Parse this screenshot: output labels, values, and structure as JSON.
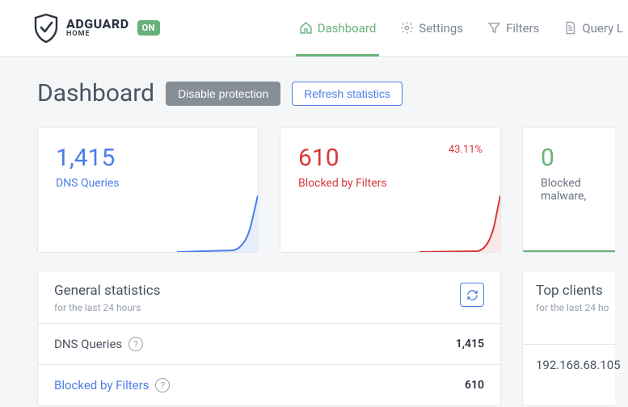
{
  "brand": {
    "name": "ADGUARD",
    "sub": "HOME",
    "status": "ON"
  },
  "nav": {
    "dashboard": "Dashboard",
    "settings": "Settings",
    "filters": "Filters",
    "querylog": "Query L"
  },
  "title": "Dashboard",
  "buttons": {
    "disable": "Disable protection",
    "refresh": "Refresh statistics"
  },
  "cards": {
    "queries": {
      "value": "1,415",
      "label": "DNS Queries"
    },
    "blocked": {
      "value": "610",
      "label": "Blocked by Filters",
      "pct": "43.11%"
    },
    "malware": {
      "value": "0",
      "label": "Blocked malware,"
    }
  },
  "stats": {
    "title": "General statistics",
    "sub": "for the last 24 hours",
    "rows": [
      {
        "label": "DNS Queries",
        "value": "1,415",
        "link": false
      },
      {
        "label": "Blocked by Filters",
        "value": "610",
        "link": true
      }
    ]
  },
  "clients": {
    "title": "Top clients",
    "sub": "for the last 24 ho",
    "rows": [
      "192.168.68.105"
    ]
  }
}
